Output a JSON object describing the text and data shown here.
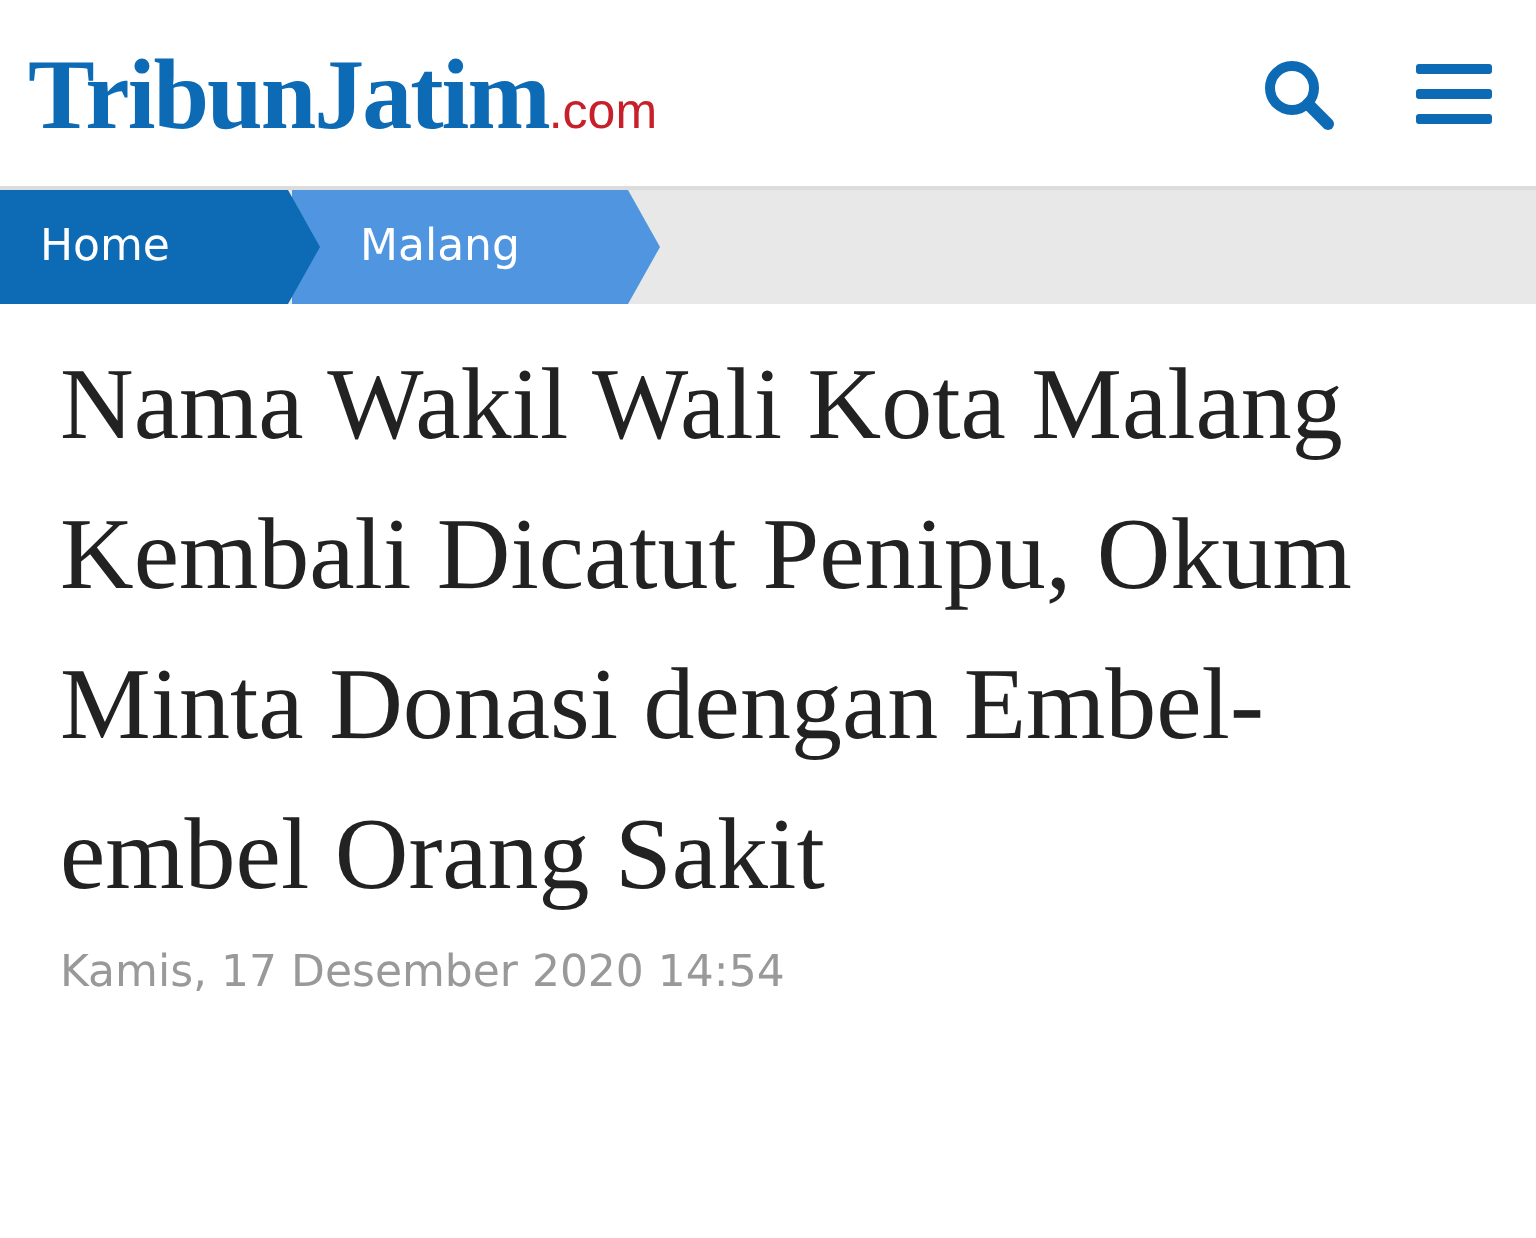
{
  "header": {
    "logo": {
      "name": "TribunJatim",
      "suffix": ".com"
    }
  },
  "breadcrumb": [
    {
      "label": "Home",
      "current": false
    },
    {
      "label": "Malang",
      "current": true
    }
  ],
  "article": {
    "title": "Nama Wakil Wali Kota Malang Kembali Dicatut Penipu, Okum Minta Donasi dengan Embel-embel Orang Sakit",
    "date": "Kamis, 17 Desember 2020 14:54"
  }
}
